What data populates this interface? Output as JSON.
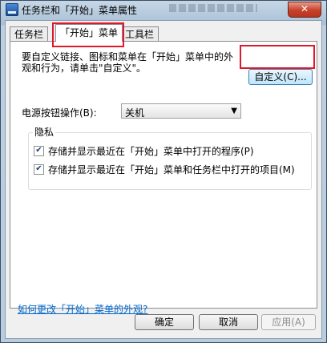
{
  "window": {
    "title": "任务栏和「开始」菜单属性",
    "close_label": "✕"
  },
  "tabs": [
    {
      "label": "任务栏",
      "active": false
    },
    {
      "label": "「开始」菜单",
      "active": true
    },
    {
      "label": "工具栏",
      "active": false
    }
  ],
  "panel": {
    "description": "要自定义链接、图标和菜单在「开始」菜单中的外观和行为，请单击\"自定义\"。",
    "customize_button": "自定义(C)...",
    "power_label": "电源按钮操作(B):",
    "power_value": "关机",
    "privacy": {
      "title": "隐私",
      "options": [
        {
          "label": "存储并显示最近在「开始」菜单中打开的程序(P)",
          "checked": true
        },
        {
          "label": "存储并显示最近在「开始」菜单和任务栏中打开的项目(M)",
          "checked": true
        }
      ]
    },
    "help_link": "如何更改「开始」菜单的外观?"
  },
  "footer": {
    "ok": "确定",
    "cancel": "取消",
    "apply": "应用(A)"
  },
  "colors": {
    "highlight": "#e0182a",
    "link": "#0066cc"
  }
}
